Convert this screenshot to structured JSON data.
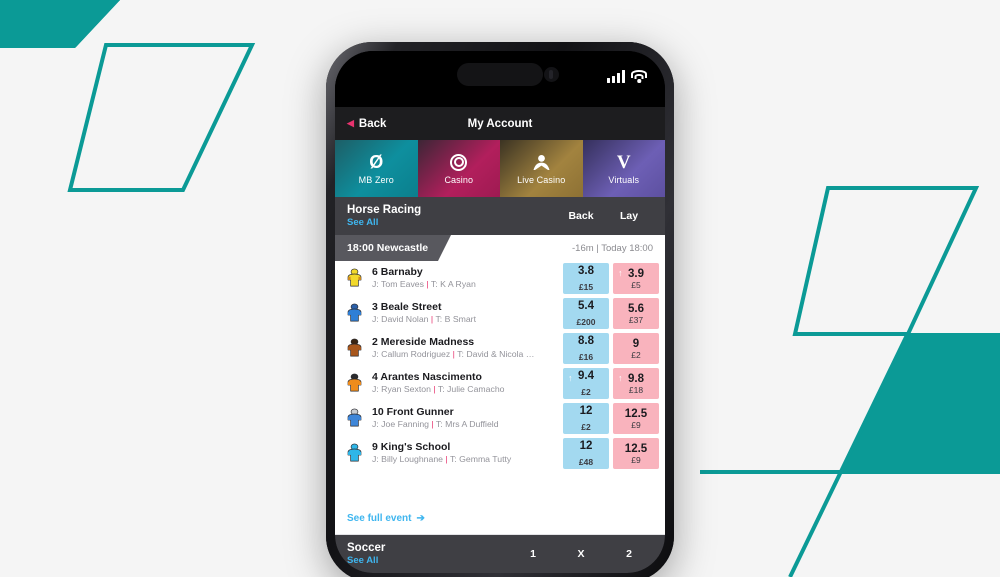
{
  "theme": {
    "accent_teal": "#0b9a96",
    "page_bg": "#f5f5f5",
    "back_blue": "#a3d9f0",
    "lay_pink": "#f9b3bd",
    "link_blue": "#3fb6ef",
    "header_gray": "#3f3f44"
  },
  "phone": {
    "status_bar": {
      "signal_icon": "signal-bars-icon",
      "wifi_icon": "wifi-icon"
    },
    "app_header": {
      "back_label": "Back",
      "back_chevron_icon": "chevron-left-icon",
      "title": "My Account"
    },
    "quick_tabs": [
      {
        "label": "MB Zero",
        "icon": "zero-slash-icon"
      },
      {
        "label": "Casino",
        "icon": "casino-chip-icon"
      },
      {
        "label": "Live Casino",
        "icon": "live-dealer-icon"
      },
      {
        "label": "Virtuals",
        "icon": "virtuals-v-icon"
      }
    ],
    "horse_racing": {
      "title": "Horse Racing",
      "see_all": "See All",
      "columns": [
        "Back",
        "Lay"
      ],
      "race_tab": "18:00 Newcastle",
      "race_time": "-16m | Today 18:00",
      "runners": [
        {
          "name": "6 Barnaby",
          "meta_jockey": "J: Tom Eaves",
          "meta_sep": "|",
          "meta_trainer": "T: K A Ryan",
          "silk_body": "#f2d92b",
          "silk_cap": "#f2d92b",
          "silk_sleeve": "#cf8b1d",
          "back": {
            "odds": "3.8",
            "amount": "£15",
            "arrow": ""
          },
          "lay": {
            "odds": "3.9",
            "amount": "£5",
            "arrow": "↑"
          }
        },
        {
          "name": "3 Beale Street",
          "meta_jockey": "J: David Nolan",
          "meta_sep": "|",
          "meta_trainer": "T: B Smart",
          "silk_body": "#2f7fd6",
          "silk_cap": "#2b5fa8",
          "silk_sleeve": "#2f7fd6",
          "back": {
            "odds": "5.4",
            "amount": "£200",
            "arrow": ""
          },
          "lay": {
            "odds": "5.6",
            "amount": "£37",
            "arrow": ""
          }
        },
        {
          "name": "2 Mereside Madness",
          "meta_jockey": "J: Callum Rodriguez",
          "meta_sep": "|",
          "meta_trainer": "T: David & Nicola …",
          "silk_body": "#a7561c",
          "silk_cap": "#3a2412",
          "silk_sleeve": "#a7561c",
          "back": {
            "odds": "8.8",
            "amount": "£16",
            "arrow": ""
          },
          "lay": {
            "odds": "9",
            "amount": "£2",
            "arrow": ""
          }
        },
        {
          "name": "4 Arantes Nascimento",
          "meta_jockey": "J: Ryan Sexton",
          "meta_sep": "|",
          "meta_trainer": "T: Julie Camacho",
          "silk_body": "#ef8c1c",
          "silk_cap": "#2a2a2e",
          "silk_sleeve": "#ef8c1c",
          "back": {
            "odds": "9.4",
            "amount": "£2",
            "arrow": "↑"
          },
          "lay": {
            "odds": "9.8",
            "amount": "£18",
            "arrow": "↑"
          }
        },
        {
          "name": "10 Front Gunner",
          "meta_jockey": "J: Joe Fanning",
          "meta_sep": "|",
          "meta_trainer": "T: Mrs A Duffield",
          "silk_body": "#3f86d8",
          "silk_cap": "#c8ccd2",
          "silk_sleeve": "#3f86d8",
          "back": {
            "odds": "12",
            "amount": "£2",
            "arrow": ""
          },
          "lay": {
            "odds": "12.5",
            "amount": "£9",
            "arrow": ""
          }
        },
        {
          "name": "9 King's School",
          "meta_jockey": "J: Billy Loughnane",
          "meta_sep": "|",
          "meta_trainer": "T: Gemma Tutty",
          "silk_body": "#2fb6e8",
          "silk_cap": "#2fb6e8",
          "silk_sleeve": "#2fb6e8",
          "back": {
            "odds": "12",
            "amount": "£48",
            "arrow": ""
          },
          "lay": {
            "odds": "12.5",
            "amount": "£9",
            "arrow": ""
          }
        }
      ],
      "see_full_event": "See full event",
      "see_full_arrow_icon": "arrow-right-icon"
    },
    "soccer": {
      "title": "Soccer",
      "see_all": "See All",
      "columns": [
        "1",
        "X",
        "2"
      ]
    }
  }
}
